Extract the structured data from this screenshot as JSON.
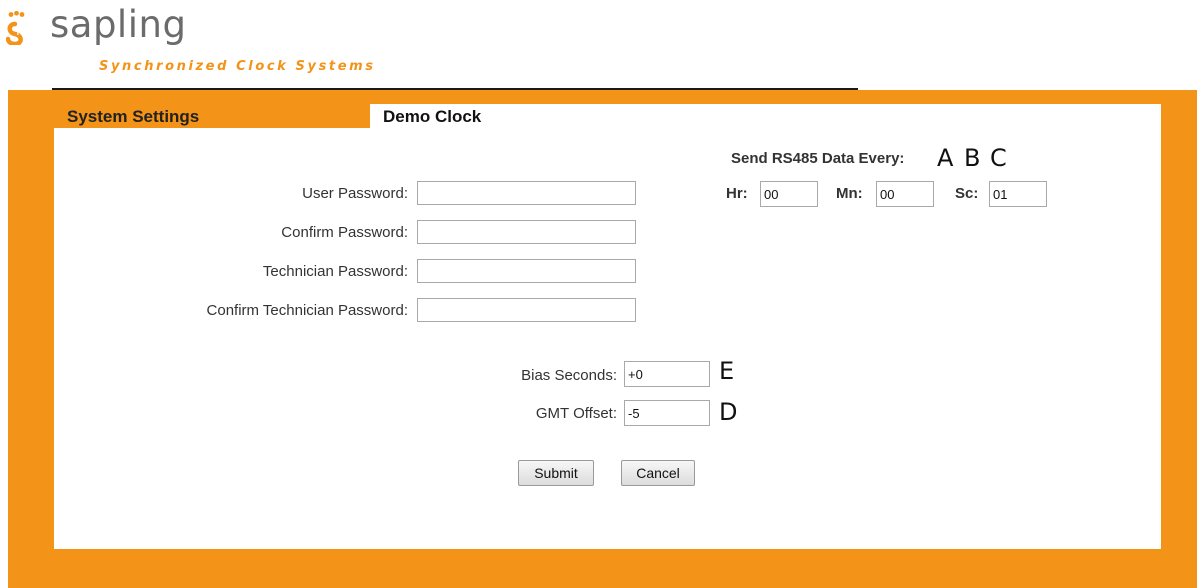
{
  "brand": {
    "name": "sapling",
    "tagline": "Synchronized Clock Systems",
    "accent_color": "#f39318",
    "icon": "sapling-logo-icon"
  },
  "tabs": {
    "system_settings": "System Settings",
    "demo_clock": "Demo Clock"
  },
  "form": {
    "user_password_label": "User Password:",
    "confirm_password_label": "Confirm Password:",
    "technician_password_label": "Technician Password:",
    "confirm_technician_password_label": "Confirm Technician Password:",
    "user_password": "",
    "confirm_password": "",
    "technician_password": "",
    "confirm_technician_password": ""
  },
  "rs485": {
    "title": "Send RS485 Data Every:",
    "hr_label": "Hr:",
    "hr_value": "00",
    "mn_label": "Mn:",
    "mn_value": "00",
    "sc_label": "Sc:",
    "sc_value": "01"
  },
  "bias": {
    "label": "Bias Seconds:",
    "value": "+0"
  },
  "gmt": {
    "label": "GMT Offset:",
    "value": "-5"
  },
  "annotations": {
    "a": "A",
    "b": "B",
    "c": "C",
    "d": "D",
    "e": "E"
  },
  "buttons": {
    "submit": "Submit",
    "cancel": "Cancel"
  }
}
